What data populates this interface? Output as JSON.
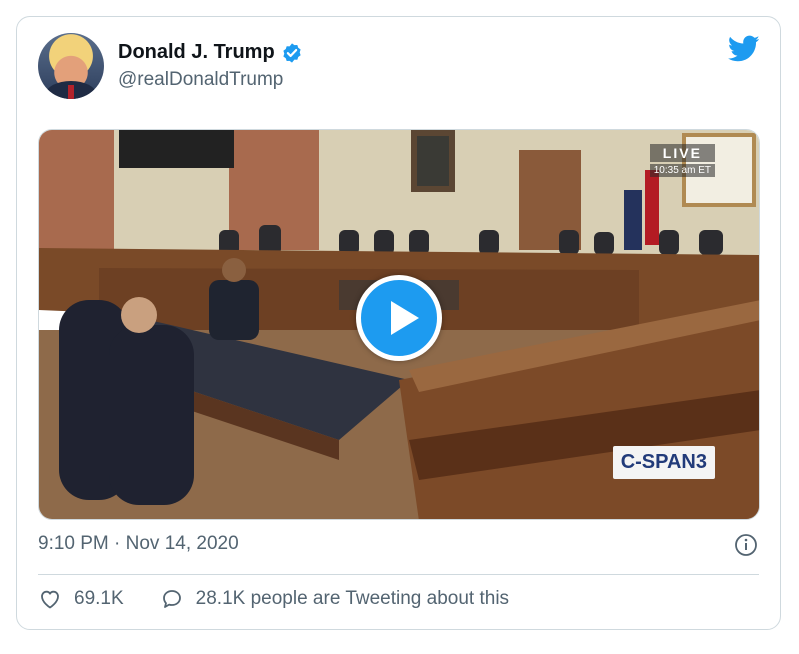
{
  "tweet": {
    "display_name": "Donald J. Trump",
    "handle": "@realDonaldTrump",
    "timestamp": "9:10 PM · Nov 14, 2020",
    "likes": "69.1K",
    "conversation": "28.1K people are Tweeting about this"
  },
  "video": {
    "live_label": "LIVE",
    "live_time": "10:35 am ET",
    "network_label": "C-SPAN3"
  },
  "icons": {
    "verified": "verified-badge-icon",
    "brand": "twitter-bird-icon",
    "info": "info-icon",
    "like": "heart-icon",
    "reply": "speech-bubble-icon",
    "play": "play-icon"
  },
  "colors": {
    "accent": "#1d9bf0",
    "text_primary": "#0f1419",
    "text_secondary": "#536471",
    "border": "#cfd9de"
  }
}
